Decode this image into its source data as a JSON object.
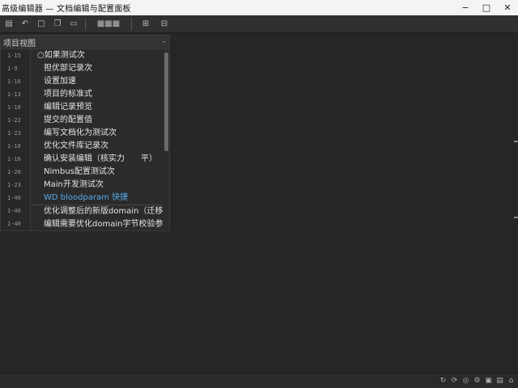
{
  "window": {
    "title": "高级编辑器 — 文档编辑与配置面板",
    "minimize_glyph": "−",
    "maximize_glyph": "□",
    "close_glyph": "✕"
  },
  "toolbar": {
    "buttons": [
      {
        "icon": "panel-icon",
        "glyph": "▤"
      },
      {
        "icon": "undo-icon",
        "glyph": "↶"
      },
      {
        "icon": "document-icon",
        "glyph": "□"
      },
      {
        "icon": "copy-icon",
        "glyph": "❐"
      },
      {
        "icon": "window-icon",
        "glyph": "▭"
      },
      {
        "icon": "layout-icon",
        "glyph": "▦▦▦"
      },
      {
        "icon": "grid-icon",
        "glyph": "⊞"
      },
      {
        "icon": "tools-icon",
        "glyph": "⊟"
      }
    ]
  },
  "panel": {
    "title": "项目视图",
    "close_glyph": "–",
    "line_numbers": [
      "1-15",
      "1-9",
      "1-16",
      "1-13",
      "1-10",
      "1-22",
      "1-23",
      "1-10",
      "1-16",
      "1-20",
      "1-23",
      "1-40",
      "1-40",
      "1-40"
    ],
    "items": [
      "○如果测试次",
      "担优部记录次",
      "设置加速",
      "项目的标准式",
      "编辑记录预览",
      "提交的配置值",
      "编写文档化为测试次",
      "优化文件库记录次",
      "确认安装编辑（核实力　　平）",
      "Nimbus配置测试次",
      "Main开发测试次",
      "WD bloodparam 快捷",
      "优化调整后的新版domain（迁移校验式　　）",
      "编辑需要优化domain字节校验参数的"
    ]
  },
  "statusbar": {
    "icons": [
      {
        "icon": "sync-icon",
        "glyph": "↻"
      },
      {
        "icon": "refresh-icon",
        "glyph": "⟳"
      },
      {
        "icon": "notification-icon",
        "glyph": "◎"
      },
      {
        "icon": "settings-icon",
        "glyph": "⚙"
      },
      {
        "icon": "folder-icon",
        "glyph": "▣"
      },
      {
        "icon": "layout-icon",
        "glyph": "▤"
      },
      {
        "icon": "warning-icon",
        "glyph": "⌂"
      }
    ]
  }
}
